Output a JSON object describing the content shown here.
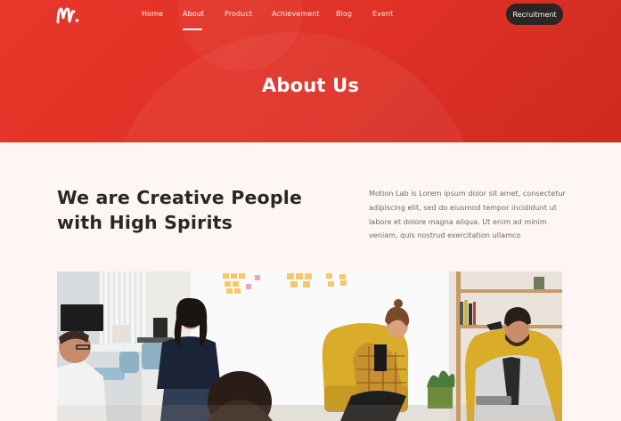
{
  "nav": {
    "logo_text": "m.",
    "items": [
      {
        "label": "Home"
      },
      {
        "label": "About"
      },
      {
        "label": "Product"
      },
      {
        "label": "Achievement"
      },
      {
        "label": "Blog"
      },
      {
        "label": "Event"
      }
    ],
    "active_item": "About",
    "cta_label": "Recruitment"
  },
  "hero": {
    "title": "About Us"
  },
  "intro": {
    "heading_line1": "We are Creative People",
    "heading_line2": "with High Spirits",
    "paragraph": "Motion Lab is Lorem ipsum dolor sit amet, consectetur adipiscing elit, sed do eiusmod tempor incididunt ut labore et dolore magna aliqua. Ut enim ad minim veniam, quis nostrud exercitation ullamco"
  },
  "colors": {
    "hero_red": "#e2332a",
    "dark_button": "#2a2624",
    "page_bg": "#fdf6f4",
    "heading": "#2b2725",
    "body_text": "#6e6a68",
    "chair_yellow": "#d9ac2a"
  },
  "photo": {
    "subject": "team-meeting-photo"
  }
}
